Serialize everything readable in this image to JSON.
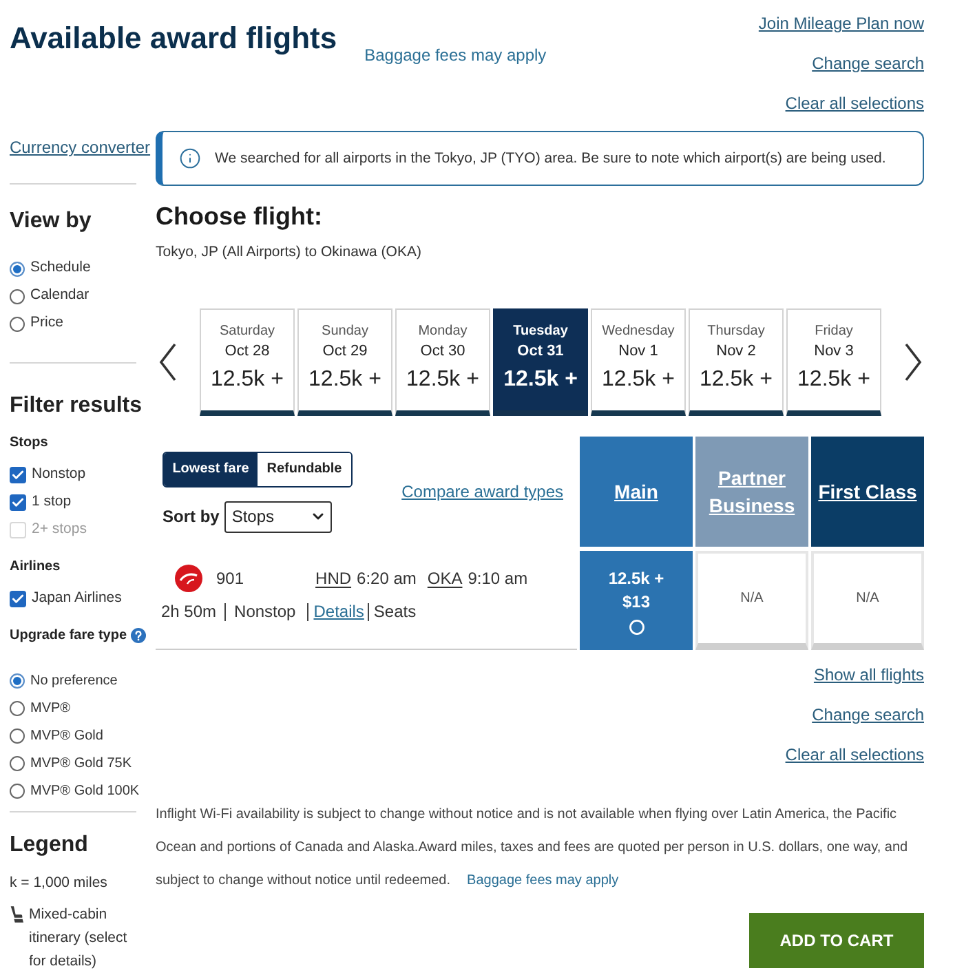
{
  "header": {
    "title": "Available award flights",
    "baggage_link": "Baggage fees may apply",
    "links": [
      "Join Mileage Plan now",
      "Change search",
      "Clear all selections"
    ]
  },
  "sidebar": {
    "currency_link": "Currency converter",
    "view_by": {
      "title": "View by",
      "options": [
        {
          "label": "Schedule",
          "selected": true
        },
        {
          "label": "Calendar",
          "selected": false
        },
        {
          "label": "Price",
          "selected": false
        }
      ]
    },
    "filters": {
      "title": "Filter results",
      "groups": [
        {
          "title": "Stops",
          "kind": "checkbox",
          "help": false,
          "options": [
            {
              "label": "Nonstop",
              "checked": true,
              "disabled": false
            },
            {
              "label": "1 stop",
              "checked": true,
              "disabled": false
            },
            {
              "label": "2+ stops",
              "checked": false,
              "disabled": true
            }
          ]
        },
        {
          "title": "Airlines",
          "kind": "checkbox",
          "help": false,
          "options": [
            {
              "label": "Japan Airlines",
              "checked": true,
              "disabled": false
            }
          ]
        },
        {
          "title": "Upgrade fare type",
          "kind": "radio",
          "help": true,
          "options": [
            {
              "label": "No preference",
              "selected": true
            },
            {
              "label": "MVP®",
              "selected": false
            },
            {
              "label": "MVP® Gold",
              "selected": false
            },
            {
              "label": "MVP® Gold 75K",
              "selected": false
            },
            {
              "label": "MVP® Gold 100K",
              "selected": false
            }
          ]
        }
      ]
    },
    "legend": {
      "title": "Legend",
      "items": [
        {
          "kind": "text",
          "label": "k = 1,000 miles"
        },
        {
          "kind": "seat",
          "label": "Mixed-cabin itinerary (select for details)"
        }
      ]
    }
  },
  "notice": {
    "text": "We searched for all airports in the Tokyo, JP (TYO) area. Be sure to note which airport(s) are being used."
  },
  "choose_flight": {
    "title": "Choose flight:",
    "route": "Tokyo, JP (All Airports) to Okinawa (OKA)"
  },
  "dates": [
    {
      "day": "Saturday",
      "date": "Oct 28",
      "price": "12.5k +",
      "selected": false
    },
    {
      "day": "Sunday",
      "date": "Oct 29",
      "price": "12.5k +",
      "selected": false
    },
    {
      "day": "Monday",
      "date": "Oct 30",
      "price": "12.5k +",
      "selected": false
    },
    {
      "day": "Tuesday",
      "date": "Oct 31",
      "price": "12.5k +",
      "selected": true
    },
    {
      "day": "Wednesday",
      "date": "Nov 1",
      "price": "12.5k +",
      "selected": false
    },
    {
      "day": "Thursday",
      "date": "Nov 2",
      "price": "12.5k +",
      "selected": false
    },
    {
      "day": "Friday",
      "date": "Nov 3",
      "price": "12.5k +",
      "selected": false
    }
  ],
  "fare_types": [
    {
      "label": "Lowest fare",
      "selected": true
    },
    {
      "label": "Refundable",
      "selected": false
    }
  ],
  "sort": {
    "label": "Sort by",
    "value": "Stops"
  },
  "compare_link": "Compare award types",
  "cabins": [
    {
      "label": "Main",
      "color": "#2b73b0"
    },
    {
      "label": "Partner Business",
      "color": "#7f9ab5"
    },
    {
      "label": "First Class",
      "color": "#0b3d66"
    }
  ],
  "flights": [
    {
      "flight_number": "901",
      "origin": "HND",
      "depart": "6:20 am",
      "destination": "OKA",
      "arrive": "9:10 am",
      "duration": "2h 50m",
      "stops": "Nonstop",
      "details_link": "Details",
      "seats": "Seats",
      "fares": [
        {
          "kind": "price",
          "miles": "12.5k +",
          "taxes": "$13",
          "selected": false
        },
        {
          "kind": "unavailable",
          "label": "N/A"
        },
        {
          "kind": "unavailable",
          "label": "N/A"
        }
      ]
    }
  ],
  "result_links": [
    "Show all flights",
    "Change search",
    "Clear all selections"
  ],
  "disclaimer": {
    "text": "Inflight Wi-Fi availability is subject to change without notice and is not available when flying over Latin America, the Pacific Ocean and portions of Canada and Alaska.Award miles, taxes and fees are quoted per person in U.S. dollars, one way, and subject to change without notice until redeemed.",
    "link": "Baggage fees may apply"
  },
  "add_to_cart": "ADD TO CART"
}
